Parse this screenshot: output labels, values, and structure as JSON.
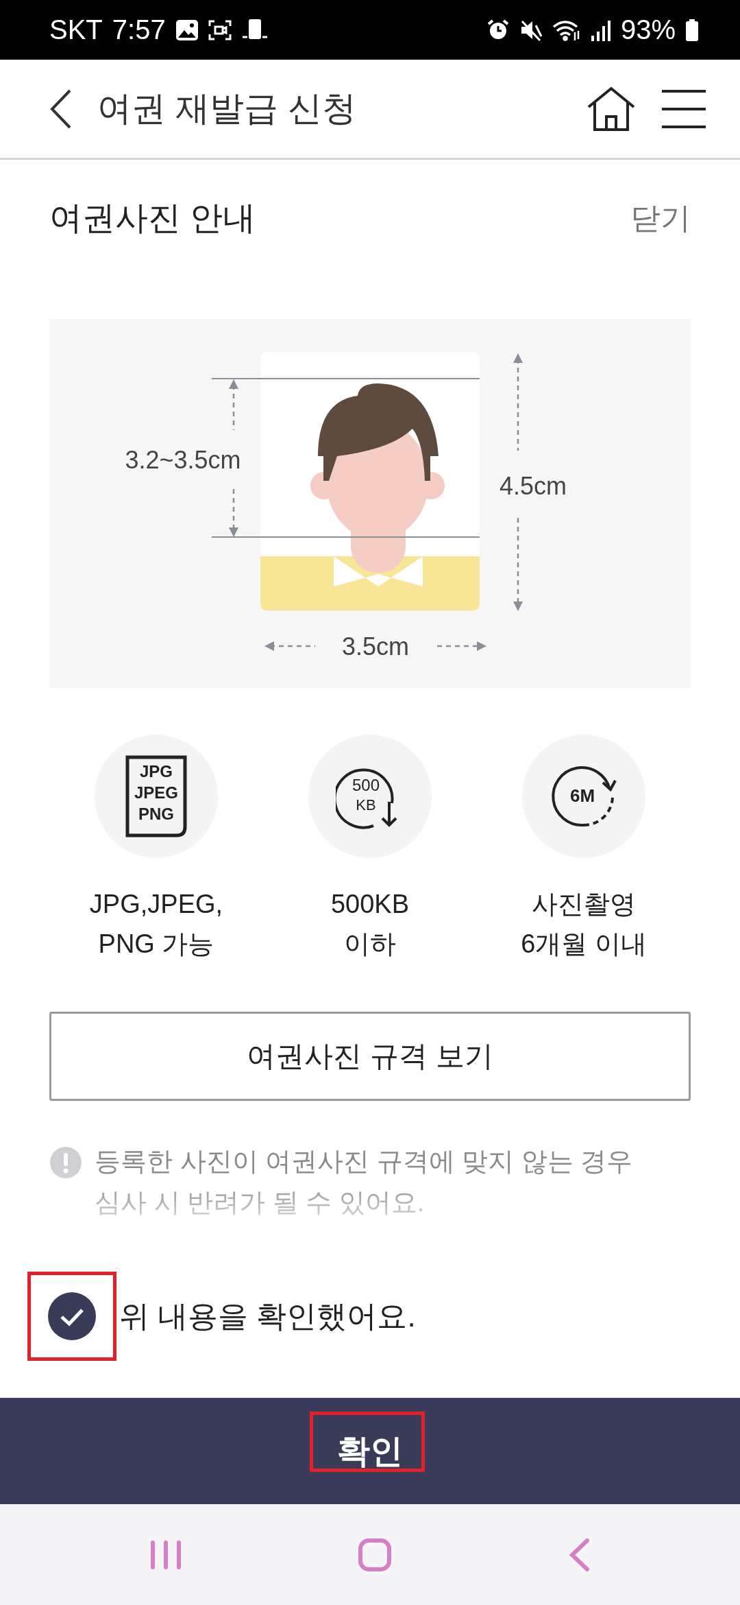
{
  "status_bar": {
    "carrier": "SKT",
    "time": "7:57",
    "battery": "93%"
  },
  "header": {
    "title": "여권 재발급 신청"
  },
  "section": {
    "title": "여권사진 안내",
    "close": "닫기"
  },
  "diagram": {
    "face_height": "3.2~3.5cm",
    "photo_height": "4.5cm",
    "photo_width": "3.5cm"
  },
  "requirements": [
    {
      "kind": "format",
      "icon_lines": [
        "JPG",
        "JPEG",
        "PNG"
      ],
      "lines": [
        "JPG,JPEG,",
        "PNG 가능"
      ]
    },
    {
      "kind": "size",
      "icon_lines": [
        "500",
        "KB"
      ],
      "lines": [
        "500KB",
        "이하"
      ]
    },
    {
      "kind": "recency",
      "icon_lines": [
        "6M"
      ],
      "lines": [
        "사진촬영",
        "6개월 이내"
      ]
    }
  ],
  "spec_button": "여권사진 규격 보기",
  "warning": "등록한 사진이 여권사진 규격에 맞지 않는 경우 심사 시 반려가 될 수 있어요.",
  "sheet": {
    "agree": {
      "label": "위 내용을 확인했어요.",
      "checked": true,
      "highlighted": true
    },
    "confirm": {
      "label": "확인",
      "highlighted": true
    }
  }
}
